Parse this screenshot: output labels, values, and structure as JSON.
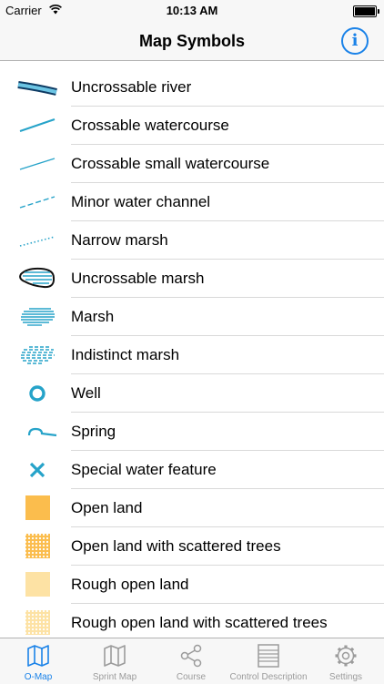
{
  "status_bar": {
    "carrier": "Carrier",
    "time": "10:13 AM"
  },
  "nav": {
    "title": "Map Symbols",
    "info_icon": "i"
  },
  "symbols": [
    {
      "label": "Uncrossable river",
      "icon": "river-icon"
    },
    {
      "label": "Crossable watercourse",
      "icon": "watercourse-icon"
    },
    {
      "label": "Crossable small watercourse",
      "icon": "small-watercourse-icon"
    },
    {
      "label": "Minor water channel",
      "icon": "minor-channel-icon"
    },
    {
      "label": "Narrow marsh",
      "icon": "narrow-marsh-icon"
    },
    {
      "label": "Uncrossable marsh",
      "icon": "uncrossable-marsh-icon"
    },
    {
      "label": "Marsh",
      "icon": "marsh-icon"
    },
    {
      "label": "Indistinct marsh",
      "icon": "indistinct-marsh-icon"
    },
    {
      "label": "Well",
      "icon": "well-icon"
    },
    {
      "label": "Spring",
      "icon": "spring-icon"
    },
    {
      "label": "Special water feature",
      "icon": "special-water-icon"
    },
    {
      "label": "Open land",
      "icon": "open-land-icon"
    },
    {
      "label": "Open land with scattered trees",
      "icon": "open-land-trees-icon"
    },
    {
      "label": "Rough open land",
      "icon": "rough-open-land-icon"
    },
    {
      "label": "Rough open land with scattered trees",
      "icon": "rough-open-land-trees-icon"
    }
  ],
  "tabs": [
    {
      "label": "O-Map",
      "icon": "map-icon",
      "active": true
    },
    {
      "label": "Sprint Map",
      "icon": "map-icon",
      "active": false
    },
    {
      "label": "Course",
      "icon": "share-icon",
      "active": false
    },
    {
      "label": "Control Description",
      "icon": "table-icon",
      "active": false
    },
    {
      "label": "Settings",
      "icon": "gear-icon",
      "active": false
    }
  ],
  "colors": {
    "water_blue": "#26a3c9",
    "yellow": "#fbbd4d",
    "light_yellow": "#fde2a4",
    "accent": "#1a82e8",
    "tab_gray": "#9b9b9b"
  }
}
